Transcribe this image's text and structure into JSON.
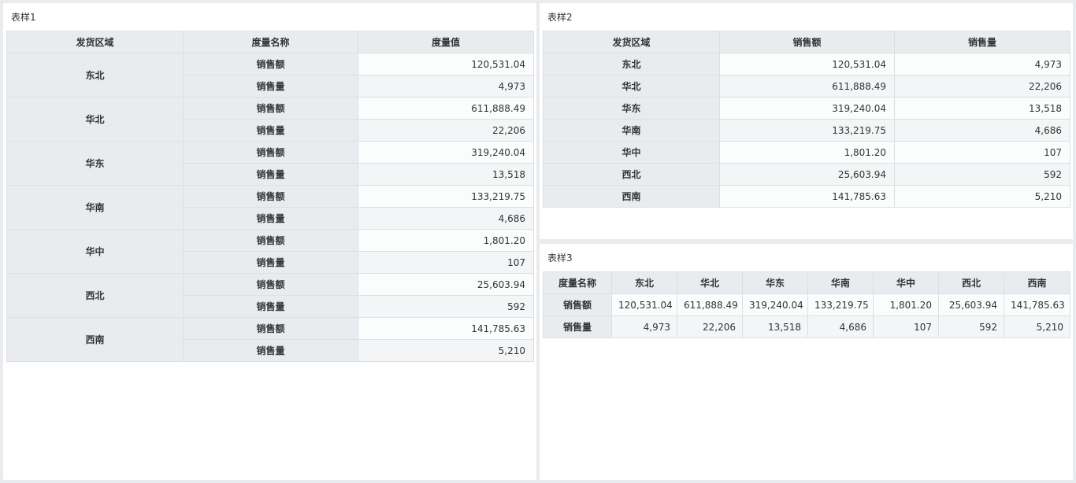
{
  "table1": {
    "title": "表样1",
    "headers": [
      "发货区域",
      "度量名称",
      "度量值"
    ],
    "rows": [
      {
        "region": "东北",
        "items": [
          {
            "measure": "销售额",
            "value": "120,531.04"
          },
          {
            "measure": "销售量",
            "value": "4,973"
          }
        ]
      },
      {
        "region": "华北",
        "items": [
          {
            "measure": "销售额",
            "value": "611,888.49"
          },
          {
            "measure": "销售量",
            "value": "22,206"
          }
        ]
      },
      {
        "region": "华东",
        "items": [
          {
            "measure": "销售额",
            "value": "319,240.04"
          },
          {
            "measure": "销售量",
            "value": "13,518"
          }
        ]
      },
      {
        "region": "华南",
        "items": [
          {
            "measure": "销售额",
            "value": "133,219.75"
          },
          {
            "measure": "销售量",
            "value": "4,686"
          }
        ]
      },
      {
        "region": "华中",
        "items": [
          {
            "measure": "销售额",
            "value": "1,801.20"
          },
          {
            "measure": "销售量",
            "value": "107"
          }
        ]
      },
      {
        "region": "西北",
        "items": [
          {
            "measure": "销售额",
            "value": "25,603.94"
          },
          {
            "measure": "销售量",
            "value": "592"
          }
        ]
      },
      {
        "region": "西南",
        "items": [
          {
            "measure": "销售额",
            "value": "141,785.63"
          },
          {
            "measure": "销售量",
            "value": "5,210"
          }
        ]
      }
    ]
  },
  "table2": {
    "title": "表样2",
    "headers": [
      "发货区域",
      "销售额",
      "销售量"
    ],
    "rows": [
      [
        "东北",
        "120,531.04",
        "4,973"
      ],
      [
        "华北",
        "611,888.49",
        "22,206"
      ],
      [
        "华东",
        "319,240.04",
        "13,518"
      ],
      [
        "华南",
        "133,219.75",
        "4,686"
      ],
      [
        "华中",
        "1,801.20",
        "107"
      ],
      [
        "西北",
        "25,603.94",
        "592"
      ],
      [
        "西南",
        "141,785.63",
        "5,210"
      ]
    ]
  },
  "table3": {
    "title": "表样3",
    "headers": [
      "度量名称",
      "东北",
      "华北",
      "华东",
      "华南",
      "华中",
      "西北",
      "西南"
    ],
    "rows": [
      [
        "销售额",
        "120,531.04",
        "611,888.49",
        "319,240.04",
        "133,219.75",
        "1,801.20",
        "25,603.94",
        "141,785.63"
      ],
      [
        "销售量",
        "4,973",
        "22,206",
        "13,518",
        "4,686",
        "107",
        "592",
        "5,210"
      ]
    ]
  }
}
